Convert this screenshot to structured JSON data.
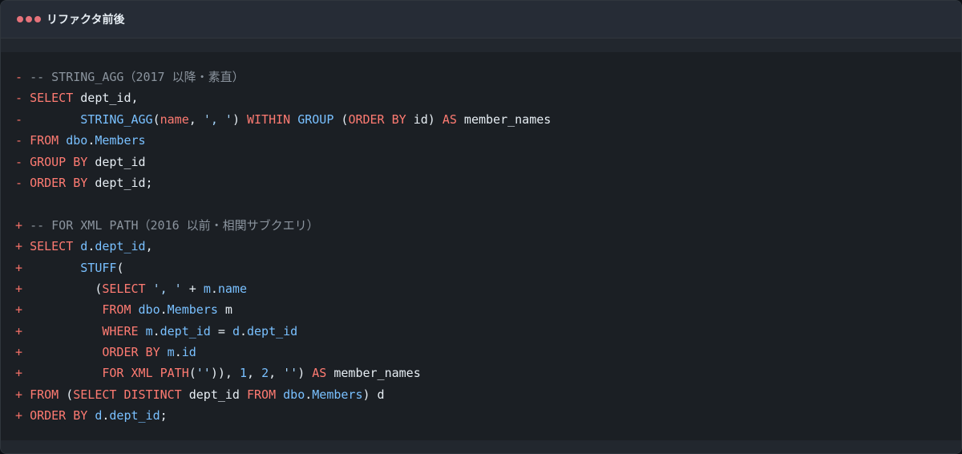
{
  "window": {
    "title": "リファクタ前後",
    "dot_color": "#e5727a"
  },
  "code": {
    "language": "sql",
    "lines": [
      {
        "tokens": [
          {
            "t": "- ",
            "c": "mk"
          },
          {
            "t": "-- STRING_AGG（2017 以降・素直）",
            "c": "c"
          }
        ]
      },
      {
        "tokens": [
          {
            "t": "- ",
            "c": "mk"
          },
          {
            "t": "SELECT",
            "c": "k"
          },
          {
            "t": " dept_id,",
            "c": "t"
          }
        ]
      },
      {
        "tokens": [
          {
            "t": "- ",
            "c": "mk"
          },
          {
            "t": "       ",
            "c": "t"
          },
          {
            "t": "STRING_AGG",
            "c": "f"
          },
          {
            "t": "(",
            "c": "t"
          },
          {
            "t": "name",
            "c": "k"
          },
          {
            "t": ", ",
            "c": "t"
          },
          {
            "t": "', '",
            "c": "s"
          },
          {
            "t": ") ",
            "c": "t"
          },
          {
            "t": "WITHIN",
            "c": "k"
          },
          {
            "t": " ",
            "c": "t"
          },
          {
            "t": "GROUP",
            "c": "f"
          },
          {
            "t": " (",
            "c": "t"
          },
          {
            "t": "ORDER BY",
            "c": "k"
          },
          {
            "t": " id) ",
            "c": "t"
          },
          {
            "t": "AS",
            "c": "k"
          },
          {
            "t": " member_names",
            "c": "t"
          }
        ]
      },
      {
        "tokens": [
          {
            "t": "- ",
            "c": "mk"
          },
          {
            "t": "FROM",
            "c": "k"
          },
          {
            "t": " ",
            "c": "t"
          },
          {
            "t": "dbo",
            "c": "f"
          },
          {
            "t": ".",
            "c": "t"
          },
          {
            "t": "Members",
            "c": "f"
          }
        ]
      },
      {
        "tokens": [
          {
            "t": "- ",
            "c": "mk"
          },
          {
            "t": "GROUP BY",
            "c": "k"
          },
          {
            "t": " dept_id",
            "c": "t"
          }
        ]
      },
      {
        "tokens": [
          {
            "t": "- ",
            "c": "mk"
          },
          {
            "t": "ORDER BY",
            "c": "k"
          },
          {
            "t": " dept_id;",
            "c": "t"
          }
        ]
      },
      {
        "tokens": []
      },
      {
        "tokens": [
          {
            "t": "+ ",
            "c": "mk"
          },
          {
            "t": "-- FOR XML PATH（2016 以前・相関サブクエリ）",
            "c": "c"
          }
        ]
      },
      {
        "tokens": [
          {
            "t": "+ ",
            "c": "mk"
          },
          {
            "t": "SELECT",
            "c": "k"
          },
          {
            "t": " ",
            "c": "t"
          },
          {
            "t": "d",
            "c": "f"
          },
          {
            "t": ".",
            "c": "t"
          },
          {
            "t": "dept_id",
            "c": "f"
          },
          {
            "t": ",",
            "c": "t"
          }
        ]
      },
      {
        "tokens": [
          {
            "t": "+ ",
            "c": "mk"
          },
          {
            "t": "       ",
            "c": "t"
          },
          {
            "t": "STUFF",
            "c": "f"
          },
          {
            "t": "(",
            "c": "t"
          }
        ]
      },
      {
        "tokens": [
          {
            "t": "+ ",
            "c": "mk"
          },
          {
            "t": "         (",
            "c": "t"
          },
          {
            "t": "SELECT",
            "c": "k"
          },
          {
            "t": " ",
            "c": "t"
          },
          {
            "t": "', '",
            "c": "s"
          },
          {
            "t": " + ",
            "c": "t"
          },
          {
            "t": "m",
            "c": "f"
          },
          {
            "t": ".",
            "c": "t"
          },
          {
            "t": "name",
            "c": "f"
          }
        ]
      },
      {
        "tokens": [
          {
            "t": "+ ",
            "c": "mk"
          },
          {
            "t": "          ",
            "c": "t"
          },
          {
            "t": "FROM",
            "c": "k"
          },
          {
            "t": " ",
            "c": "t"
          },
          {
            "t": "dbo",
            "c": "f"
          },
          {
            "t": ".",
            "c": "t"
          },
          {
            "t": "Members",
            "c": "f"
          },
          {
            "t": " m",
            "c": "t"
          }
        ]
      },
      {
        "tokens": [
          {
            "t": "+ ",
            "c": "mk"
          },
          {
            "t": "          ",
            "c": "t"
          },
          {
            "t": "WHERE",
            "c": "k"
          },
          {
            "t": " ",
            "c": "t"
          },
          {
            "t": "m",
            "c": "f"
          },
          {
            "t": ".",
            "c": "t"
          },
          {
            "t": "dept_id",
            "c": "f"
          },
          {
            "t": " = ",
            "c": "t"
          },
          {
            "t": "d",
            "c": "f"
          },
          {
            "t": ".",
            "c": "t"
          },
          {
            "t": "dept_id",
            "c": "f"
          }
        ]
      },
      {
        "tokens": [
          {
            "t": "+ ",
            "c": "mk"
          },
          {
            "t": "          ",
            "c": "t"
          },
          {
            "t": "ORDER BY",
            "c": "k"
          },
          {
            "t": " ",
            "c": "t"
          },
          {
            "t": "m",
            "c": "f"
          },
          {
            "t": ".",
            "c": "t"
          },
          {
            "t": "id",
            "c": "f"
          }
        ]
      },
      {
        "tokens": [
          {
            "t": "+ ",
            "c": "mk"
          },
          {
            "t": "          ",
            "c": "t"
          },
          {
            "t": "FOR XML PATH",
            "c": "k"
          },
          {
            "t": "(",
            "c": "t"
          },
          {
            "t": "''",
            "c": "s"
          },
          {
            "t": ")), ",
            "c": "t"
          },
          {
            "t": "1",
            "c": "f"
          },
          {
            "t": ", ",
            "c": "t"
          },
          {
            "t": "2",
            "c": "f"
          },
          {
            "t": ", ",
            "c": "t"
          },
          {
            "t": "''",
            "c": "s"
          },
          {
            "t": ") ",
            "c": "t"
          },
          {
            "t": "AS",
            "c": "k"
          },
          {
            "t": " member_names",
            "c": "t"
          }
        ]
      },
      {
        "tokens": [
          {
            "t": "+ ",
            "c": "mk"
          },
          {
            "t": "FROM",
            "c": "k"
          },
          {
            "t": " (",
            "c": "t"
          },
          {
            "t": "SELECT DISTINCT",
            "c": "k"
          },
          {
            "t": " dept_id ",
            "c": "t"
          },
          {
            "t": "FROM",
            "c": "k"
          },
          {
            "t": " ",
            "c": "t"
          },
          {
            "t": "dbo",
            "c": "f"
          },
          {
            "t": ".",
            "c": "t"
          },
          {
            "t": "Members",
            "c": "f"
          },
          {
            "t": ") d",
            "c": "t"
          }
        ]
      },
      {
        "tokens": [
          {
            "t": "+ ",
            "c": "mk"
          },
          {
            "t": "ORDER BY",
            "c": "k"
          },
          {
            "t": " ",
            "c": "t"
          },
          {
            "t": "d",
            "c": "f"
          },
          {
            "t": ".",
            "c": "t"
          },
          {
            "t": "dept_id",
            "c": "f"
          },
          {
            "t": ";",
            "c": "t"
          }
        ]
      }
    ]
  }
}
